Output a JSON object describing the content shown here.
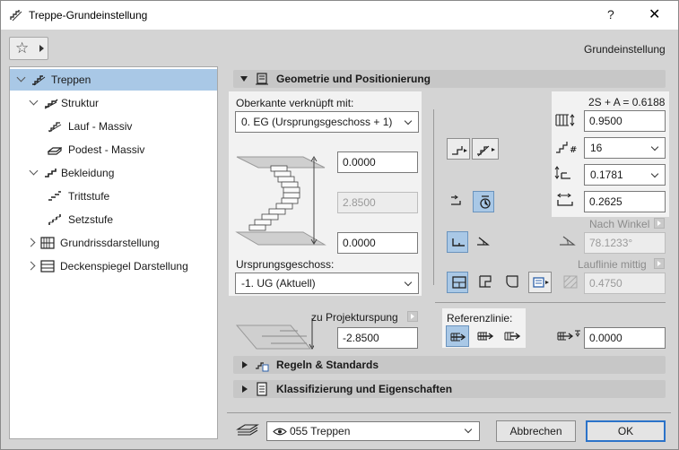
{
  "window": {
    "title": "Treppe-Grundeinstellung",
    "help": "?",
    "close": "✕",
    "header_right": "Grundeinstellung"
  },
  "favorites": {
    "icon": "star-icon"
  },
  "tree": {
    "items": [
      {
        "label": "Treppen",
        "icon": "stairs-icon",
        "selected": true
      },
      {
        "label": "Struktur",
        "icon": "structure-icon"
      },
      {
        "label": "Lauf - Massiv",
        "icon": "flight-icon"
      },
      {
        "label": "Podest - Massiv",
        "icon": "landing-icon"
      },
      {
        "label": "Bekleidung",
        "icon": "finish-icon"
      },
      {
        "label": "Trittstufe",
        "icon": "tread-icon"
      },
      {
        "label": "Setzstufe",
        "icon": "riser-icon"
      },
      {
        "label": "Grundrissdarstellung",
        "icon": "floorplan-icon"
      },
      {
        "label": "Deckenspiegel Darstellung",
        "icon": "ceiling-plan-icon"
      }
    ]
  },
  "sections": {
    "geometry": "Geometrie und Positionierung",
    "rules": "Regeln & Standards",
    "classification": "Klassifizierung und Eigenschaften"
  },
  "geometry": {
    "top_link_label": "Oberkante verknüpft mit:",
    "top_link_value": "0. EG (Ursprungsgeschoss + 1)",
    "top_offset": "0.0000",
    "height": "2.8500",
    "bottom_offset": "0.0000",
    "origin_story_label": "Ursprungsgeschoss:",
    "origin_story_value": "-1. UG (Aktuell)",
    "project_zero_label": "zu Projekturspung",
    "project_zero_value": "-2.8500",
    "formula": "2S + A = 0.6188",
    "flight_width": "0.9500",
    "riser_count": "16",
    "riser_height": "0.1781",
    "tread_depth": "0.2625",
    "angle_mode_label": "Nach Winkel",
    "angle_value": "78.1233°",
    "walkline_label": "Lauflinie mittig",
    "walkline_value": "0.4750",
    "reference_line_label": "Referenzlinie:",
    "reference_offset": "0.0000"
  },
  "footer": {
    "layer_value": "055 Treppen",
    "cancel": "Abbrechen",
    "ok": "OK"
  }
}
